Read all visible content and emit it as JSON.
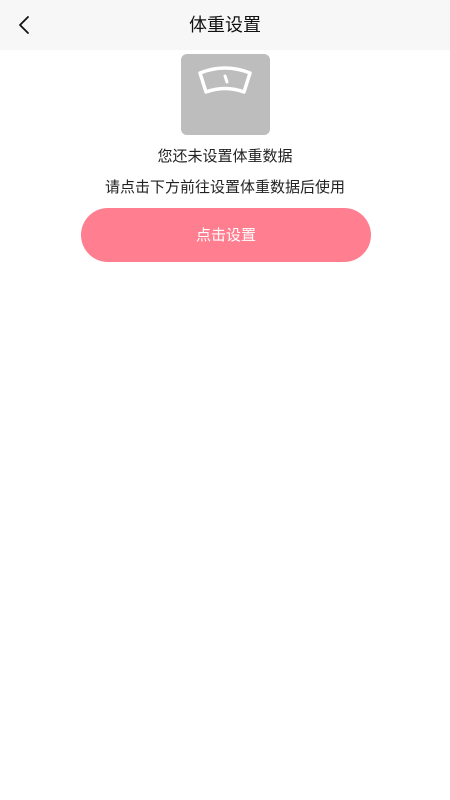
{
  "header": {
    "title": "体重设置",
    "back_icon": "chevron-left-icon"
  },
  "empty_state": {
    "icon": "scale-icon",
    "icon_bg_color": "#bdbdbd",
    "message_primary": "您还未设置体重数据",
    "message_secondary": "请点击下方前往设置体重数据后使用",
    "button_label": "点击设置",
    "button_color": "#ff7f90"
  }
}
